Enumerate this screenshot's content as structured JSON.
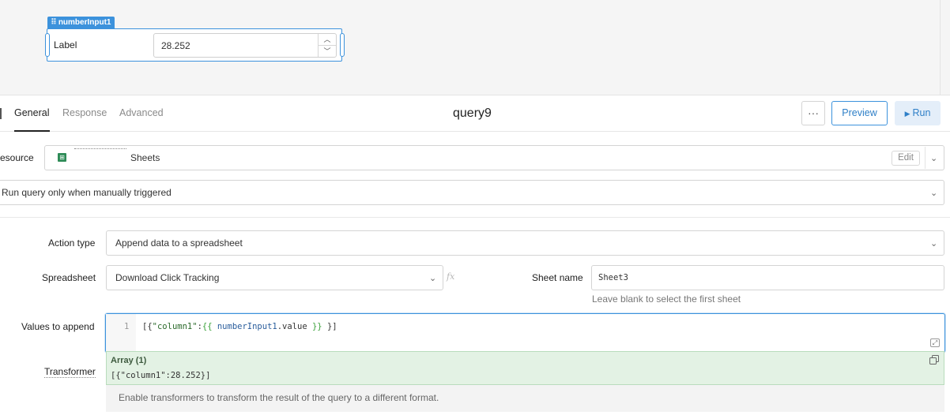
{
  "canvas": {
    "component_tag": "numberInput1",
    "label": "Label",
    "value": "28.252"
  },
  "query": {
    "tabs": [
      "General",
      "Response",
      "Advanced"
    ],
    "active_tab": "General",
    "title": "query9",
    "more_label": "···",
    "preview_label": "Preview",
    "run_label": "Run"
  },
  "resource": {
    "label": "esource",
    "value": "Sheets",
    "edit_label": "Edit"
  },
  "trigger": {
    "value": "Run query only when manually triggered"
  },
  "form": {
    "action_type_label": "Action type",
    "action_type_value": "Append data to a spreadsheet",
    "spreadsheet_label": "Spreadsheet",
    "spreadsheet_value": "Download Click Tracking",
    "fx_label": "fx",
    "sheet_name_label": "Sheet name",
    "sheet_name_value": "Sheet3",
    "sheet_name_hint": "Leave blank to select the first sheet",
    "values_label": "Values to append",
    "code_line_number": "1",
    "code_tokens": {
      "open": "[{",
      "key": "\"column1\"",
      "colon": ":",
      "tmpl_open": "{{ ",
      "ident": "numberInput1",
      "prop": ".value",
      "tmpl_close": " }}",
      "close": " }]"
    },
    "result_title": "Array (1)",
    "result_value": "[{\"column1\":28.252}]",
    "transformer_label": "Transformer",
    "transformer_text": "Enable transformers to transform the result of the query to a different format."
  },
  "colors": {
    "accent": "#3c92dc",
    "result_bg": "#e3f2e4",
    "sheets_green": "#2e8b57"
  }
}
